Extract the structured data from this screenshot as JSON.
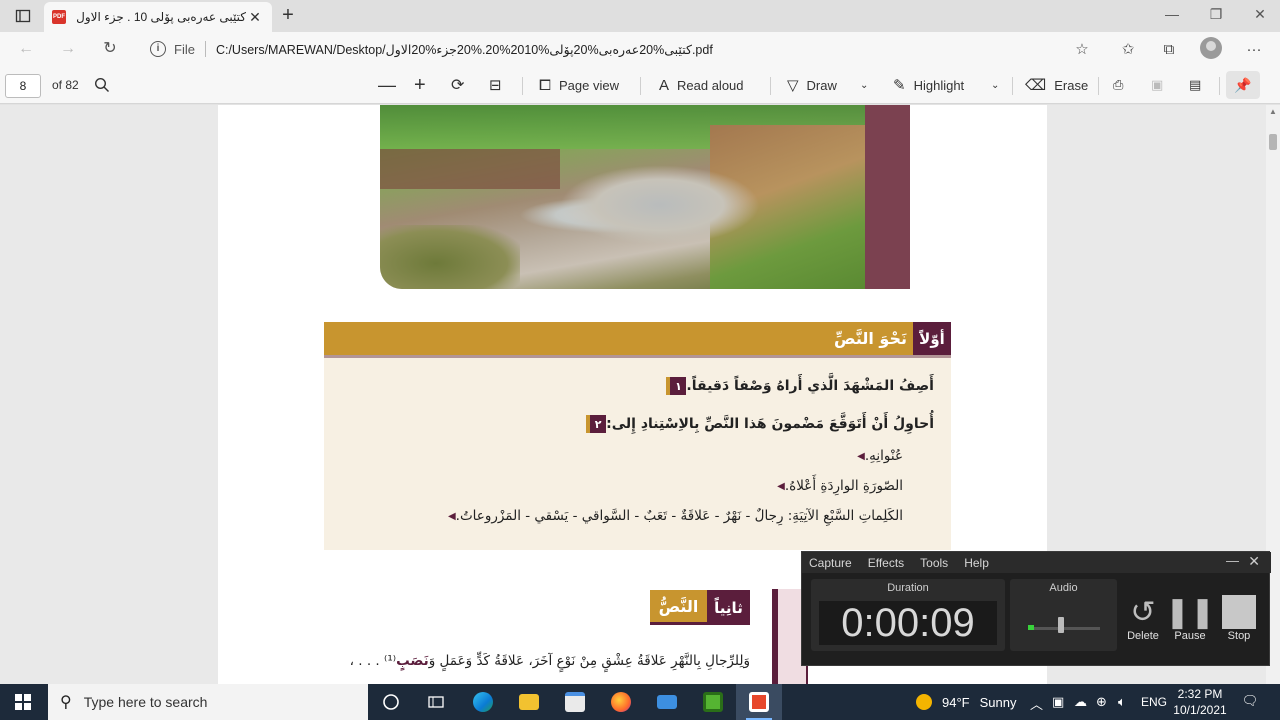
{
  "browser": {
    "tab_title": "كتێبی عەرەبی پۆلی 10 . جزء الاول.pdf",
    "file_label": "File",
    "url": "C:/Users/MAREWAN/Desktop/كتێبی%20عەرەبی%20پۆلی%2010%20.%20جزء%20الاول.pdf"
  },
  "pdf_toolbar": {
    "page_current": "8",
    "page_total": "of 82",
    "page_view": "Page view",
    "read_aloud": "Read aloud",
    "draw": "Draw",
    "highlight": "Highlight",
    "erase": "Erase"
  },
  "document": {
    "section1": {
      "badge": "أوّلاً",
      "title": "نَحْوَ النَّصِّ",
      "q1_num": "١",
      "q1": "أَصِفُ المَشْهَدَ الَّذي أَراهُ وَصْفاً دَقيقاً.",
      "q2_num": "٢",
      "q2": "أُحاوِلُ أَنْ أَتَوَقَّعَ مَضْمونَ هَذا النَّصِّ بِالاِسْتِنادِ إِلى:",
      "bullets": [
        "عُنْوانِهِ.",
        "الصّورَةِ الوارِدَةِ أَعْلاهُ.",
        "الكَلِماتِ السَّبْعِ الآتِيَةِ: رِجالٌ - نَهْرٌ - عَلاقَةٌ - تَعَبٌ - السَّواقي - يَسْقي - المَزْروعاتُ."
      ]
    },
    "section2": {
      "badge": "ثانِياً",
      "title": "النَّصُّ",
      "body": "وَلِلرِّجالِ بِالنَّهْرِ عَلاقَةُ عِشْقٍ مِنْ نَوْعٍ آخَرَ، عَلاقَةُ كَدٍّ وَعَمَلٍ وَ",
      "body_hl": "نَصَبٍ",
      "body_tail": "⁽¹⁾ . . . ،"
    }
  },
  "recorder": {
    "menu": [
      "Capture",
      "Effects",
      "Tools",
      "Help"
    ],
    "duration_label": "Duration",
    "duration": "0:00:09",
    "audio_label": "Audio",
    "audio_level": 0.08,
    "delete": "Delete",
    "pause": "Pause",
    "stop": "Stop"
  },
  "taskbar": {
    "search_placeholder": "Type here to search",
    "temperature": "94°F",
    "weather": "Sunny",
    "lang": "ENG",
    "time": "2:32 PM",
    "date": "10/1/2021"
  },
  "icons": [
    "tab-actions-icon",
    "pdf-favicon-icon",
    "close-icon",
    "plus-icon",
    "back-icon",
    "forward-icon",
    "refresh-icon",
    "info-icon",
    "favorite-add-icon",
    "favorites-icon",
    "collections-icon",
    "more-icon",
    "search-icon",
    "zoom-out-icon",
    "zoom-in-icon",
    "rotate-icon",
    "fit-icon",
    "page-view-icon",
    "read-aloud-icon",
    "draw-icon",
    "highlight-icon",
    "erase-icon",
    "print-icon",
    "save-icon",
    "save-as-icon",
    "pin-icon"
  ],
  "colors": {
    "accent_gold": "#c8952f",
    "accent_maroon": "#5b1e3c",
    "section_bg": "#f7f0e3",
    "taskbar": "#1d2a3a"
  }
}
